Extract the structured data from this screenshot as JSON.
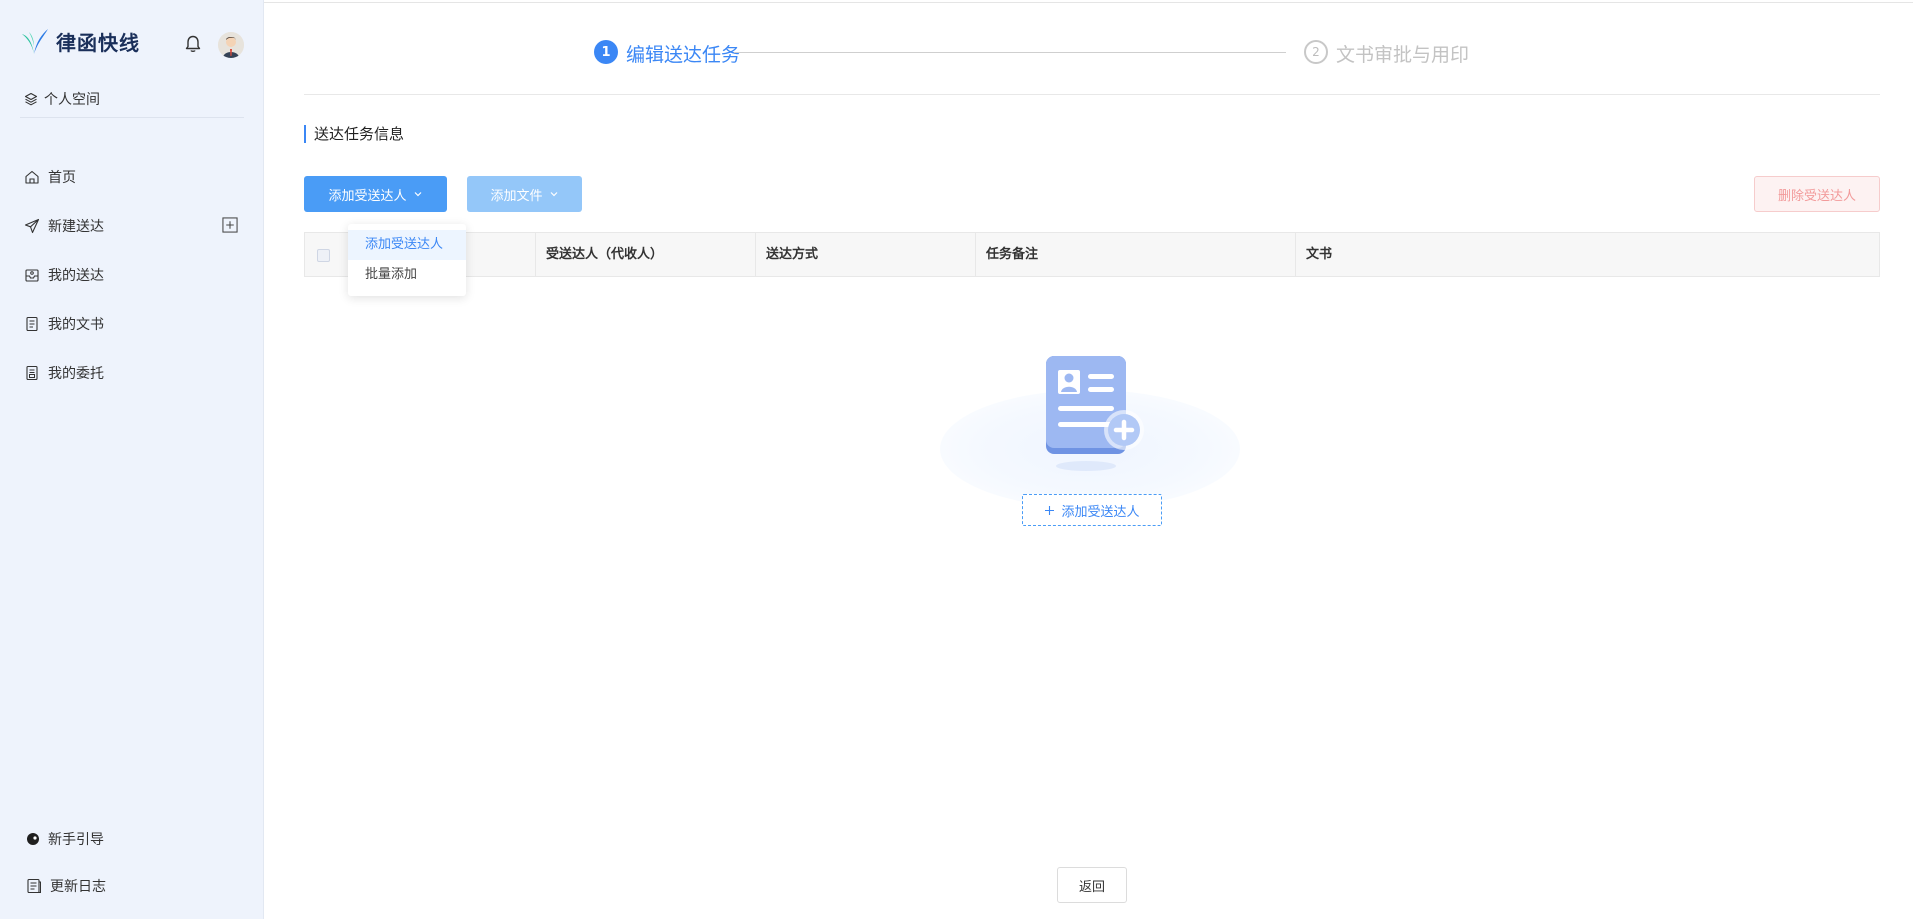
{
  "brand": {
    "name": "律函快线",
    "accent": "#3b87f5"
  },
  "sidebar": {
    "space_label": "个人空间",
    "items": [
      {
        "label": "首页",
        "icon": "home-icon"
      },
      {
        "label": "新建送达",
        "icon": "send-icon",
        "action_icon": "plus-square-icon"
      },
      {
        "label": "我的送达",
        "icon": "inbox-icon"
      },
      {
        "label": "我的文书",
        "icon": "document-icon"
      },
      {
        "label": "我的委托",
        "icon": "delegation-icon"
      }
    ],
    "footer": [
      {
        "label": "新手引导",
        "icon": "guide-icon"
      },
      {
        "label": "更新日志",
        "icon": "changelog-icon"
      }
    ]
  },
  "steps": [
    {
      "number": "1",
      "label": "编辑送达任务",
      "active": true
    },
    {
      "number": "2",
      "label": "文书审批与用印",
      "active": false
    }
  ],
  "section_title": "送达任务信息",
  "toolbar": {
    "add_recipient": "添加受送达人",
    "add_file": "添加文件",
    "delete_recipient": "删除受送达人"
  },
  "dropdown": {
    "items": [
      {
        "label": "添加受送达人",
        "active": true
      },
      {
        "label": "批量添加",
        "active": false
      }
    ]
  },
  "table": {
    "columns": [
      "",
      "受送达人（代收人）",
      "送达方式",
      "任务备注",
      "文书"
    ]
  },
  "empty_state": {
    "button_label": "添加受送达人"
  },
  "footer": {
    "back_label": "返回"
  }
}
